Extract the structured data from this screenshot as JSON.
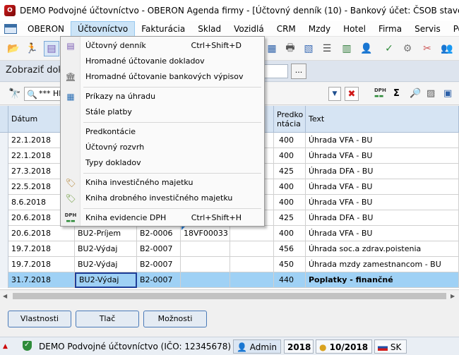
{
  "window": {
    "title": "DEMO Podvojné účtovníctvo - OBERON Agenda firmy - [Účtovný denník (10) - Bankový účet: ČSOB stavebná sporit"
  },
  "menubar": {
    "items": [
      "OBERON",
      "Účtovníctvo",
      "Fakturácia",
      "Sklad",
      "Vozidlá",
      "CRM",
      "Mzdy",
      "Hotel",
      "Firma",
      "Servis",
      "Pomocník"
    ]
  },
  "filter": {
    "label": "Zobraziť dok",
    "ellipsis": "..."
  },
  "search": {
    "value": "*** HI"
  },
  "toolbar_icons": {
    "dph": "DPH",
    "sigma": "Σ"
  },
  "grid": {
    "headers": {
      "datum": "Dátum",
      "predkontacia_line1": "Predko",
      "predkontacia_line2": "ntácia",
      "text": "Text"
    },
    "rows": [
      {
        "datum": "22.1.2018",
        "typ": "",
        "cislo": "",
        "vs": "",
        "predkontacia": "400",
        "text": "Úhrada VFA - BU"
      },
      {
        "datum": "22.1.2018",
        "typ": "",
        "cislo": "",
        "vs": "",
        "predkontacia": "400",
        "text": "Úhrada VFA - BU"
      },
      {
        "datum": "27.3.2018",
        "typ": "",
        "cislo": "",
        "vs": "",
        "predkontacia": "425",
        "text": "Úhrada DFA - BU"
      },
      {
        "datum": "22.5.2018",
        "typ": "",
        "cislo": "",
        "vs": "",
        "predkontacia": "400",
        "text": "Úhrada VFA - BU"
      },
      {
        "datum": "8.6.2018",
        "typ": "",
        "cislo": "",
        "vs": "",
        "predkontacia": "400",
        "text": "Úhrada VFA - BU"
      },
      {
        "datum": "20.6.2018",
        "typ": "",
        "cislo": "",
        "vs": "",
        "predkontacia": "425",
        "text": "Úhrada DFA - BU"
      },
      {
        "datum": "20.6.2018",
        "typ": "BU2-Príjem",
        "cislo": "B2-0006",
        "vs": "18VF00033",
        "predkontacia": "400",
        "text": "Úhrada VFA - BU"
      },
      {
        "datum": "19.7.2018",
        "typ": "BU2-Výdaj",
        "cislo": "B2-0007",
        "vs": "",
        "predkontacia": "456",
        "text": "Úhrada soc.a zdrav.poistenia"
      },
      {
        "datum": "19.7.2018",
        "typ": "BU2-Výdaj",
        "cislo": "B2-0007",
        "vs": "",
        "predkontacia": "450",
        "text": "Úhrada mzdy zamestnancom - BU"
      },
      {
        "datum": "31.7.2018",
        "typ": "BU2-Výdaj",
        "cislo": "B2-0007",
        "vs": "",
        "predkontacia": "440",
        "text": "Poplatky - finančné"
      }
    ]
  },
  "buttons": {
    "vlastnosti": "Vlastnosti",
    "tlac": "Tlač",
    "moznosti": "Možnosti"
  },
  "status": {
    "company": "DEMO Podvojné účtovníctvo (IČO: 12345678)",
    "user": "Admin",
    "year": "2018",
    "period": "10/2018",
    "lang": "SK"
  },
  "dropdown": {
    "items": [
      {
        "label": "Účtovný denník",
        "shortcut": "Ctrl+Shift+D"
      },
      {
        "label": "Hromadné účtovanie dokladov",
        "shortcut": ""
      },
      {
        "label": "Hromadné účtovanie bankových výpisov",
        "shortcut": ""
      },
      {
        "label": "Príkazy na úhradu",
        "shortcut": ""
      },
      {
        "label": "Stále platby",
        "shortcut": ""
      },
      {
        "label": "Predkontácie",
        "shortcut": ""
      },
      {
        "label": "Účtovný rozvrh",
        "shortcut": ""
      },
      {
        "label": "Typy dokladov",
        "shortcut": ""
      },
      {
        "label": "Kniha investičného majetku",
        "shortcut": ""
      },
      {
        "label": "Kniha drobného investičného majetku",
        "shortcut": ""
      },
      {
        "label": "Kniha evidencie DPH",
        "shortcut": "Ctrl+Shift+H"
      }
    ]
  }
}
